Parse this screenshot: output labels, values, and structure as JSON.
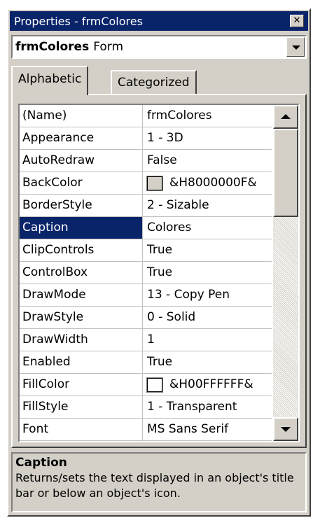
{
  "window": {
    "title": "Properties - frmColores",
    "close_glyph": "✕"
  },
  "object_combo": {
    "object_name": "frmColores",
    "object_type": "Form"
  },
  "tabs": [
    {
      "label": "Alphabetic",
      "active": true
    },
    {
      "label": "Categorized",
      "active": false
    }
  ],
  "properties": [
    {
      "name": "(Name)",
      "value": "frmColores"
    },
    {
      "name": "Appearance",
      "value": "1 - 3D"
    },
    {
      "name": "AutoRedraw",
      "value": "False"
    },
    {
      "name": "BackColor",
      "value": "&H8000000F&",
      "swatch": "#d4d0c8"
    },
    {
      "name": "BorderStyle",
      "value": "2 - Sizable"
    },
    {
      "name": "Caption",
      "value": "Colores",
      "selected": true
    },
    {
      "name": "ClipControls",
      "value": "True"
    },
    {
      "name": "ControlBox",
      "value": "True"
    },
    {
      "name": "DrawMode",
      "value": "13 - Copy Pen"
    },
    {
      "name": "DrawStyle",
      "value": "0 - Solid"
    },
    {
      "name": "DrawWidth",
      "value": "1"
    },
    {
      "name": "Enabled",
      "value": "True"
    },
    {
      "name": "FillColor",
      "value": "&H00FFFFFF&",
      "swatch": "#ffffff"
    },
    {
      "name": "FillStyle",
      "value": "1 - Transparent"
    },
    {
      "name": "Font",
      "value": "MS Sans Serif"
    }
  ],
  "description": {
    "title": "Caption",
    "text": "Returns/sets the text displayed in an object's title bar or below an object's icon."
  },
  "colors": {
    "titlebar": "#0a246a",
    "face": "#d4d0c8",
    "selection": "#0a246a"
  }
}
